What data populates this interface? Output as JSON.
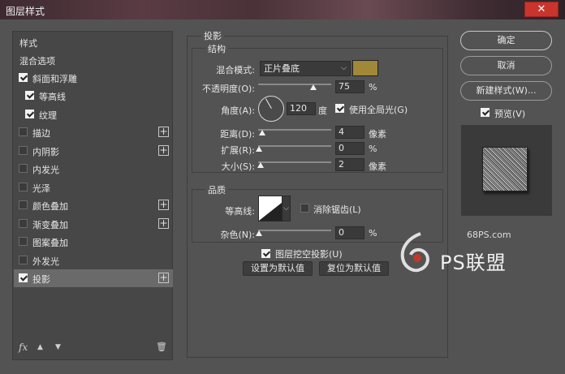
{
  "window": {
    "title": "图层样式",
    "close": "✕"
  },
  "sidebar": {
    "items": [
      {
        "label": "样式",
        "checkbox": false
      },
      {
        "label": "混合选项",
        "checkbox": false
      },
      {
        "label": "斜面和浮雕",
        "checkbox": true,
        "checked": true
      },
      {
        "label": "等高线",
        "checkbox": true,
        "checked": true,
        "sub": true
      },
      {
        "label": "纹理",
        "checkbox": true,
        "checked": true,
        "sub": true
      },
      {
        "label": "描边",
        "checkbox": true,
        "checked": false,
        "plus": true
      },
      {
        "label": "内阴影",
        "checkbox": true,
        "checked": false,
        "plus": true
      },
      {
        "label": "内发光",
        "checkbox": true,
        "checked": false
      },
      {
        "label": "光泽",
        "checkbox": true,
        "checked": false
      },
      {
        "label": "颜色叠加",
        "checkbox": true,
        "checked": false,
        "plus": true
      },
      {
        "label": "渐变叠加",
        "checkbox": true,
        "checked": false,
        "plus": true
      },
      {
        "label": "图案叠加",
        "checkbox": true,
        "checked": false
      },
      {
        "label": "外发光",
        "checkbox": true,
        "checked": false
      },
      {
        "label": "投影",
        "checkbox": true,
        "checked": true,
        "plus": true,
        "active": true
      }
    ],
    "plus_symbol": "+",
    "fx": "fx",
    "up": "▲",
    "down": "▼",
    "trash": "🗑"
  },
  "panel": {
    "title": "投影",
    "structure": {
      "title": "结构",
      "blend_mode_label": "混合模式:",
      "blend_mode_value": "正片叠底",
      "color": "#a08838",
      "opacity_label": "不透明度(O):",
      "opacity_value": "75",
      "opacity_unit": "%",
      "angle_label": "角度(A):",
      "angle_value": "120",
      "angle_unit": "度",
      "global_light_label": "使用全局光(G)",
      "global_light_checked": true,
      "distance_label": "距离(D):",
      "distance_value": "4",
      "distance_unit": "像素",
      "spread_label": "扩展(R):",
      "spread_value": "0",
      "spread_unit": "%",
      "size_label": "大小(S):",
      "size_value": "2",
      "size_unit": "像素"
    },
    "quality": {
      "title": "品质",
      "contour_label": "等高线:",
      "antialias_label": "消除锯齿(L)",
      "antialias_checked": false,
      "noise_label": "杂色(N):",
      "noise_value": "0",
      "noise_unit": "%"
    },
    "knockout_label": "图层挖空投影(U)",
    "knockout_checked": true,
    "set_default": "设置为默认值",
    "reset_default": "复位为默认值"
  },
  "right": {
    "ok": "确定",
    "cancel": "取消",
    "new_style": "新建样式(W)...",
    "preview_label": "预览(V)",
    "preview_checked": true
  },
  "watermark": {
    "site": "68PS.com",
    "brand": "PS联盟"
  }
}
